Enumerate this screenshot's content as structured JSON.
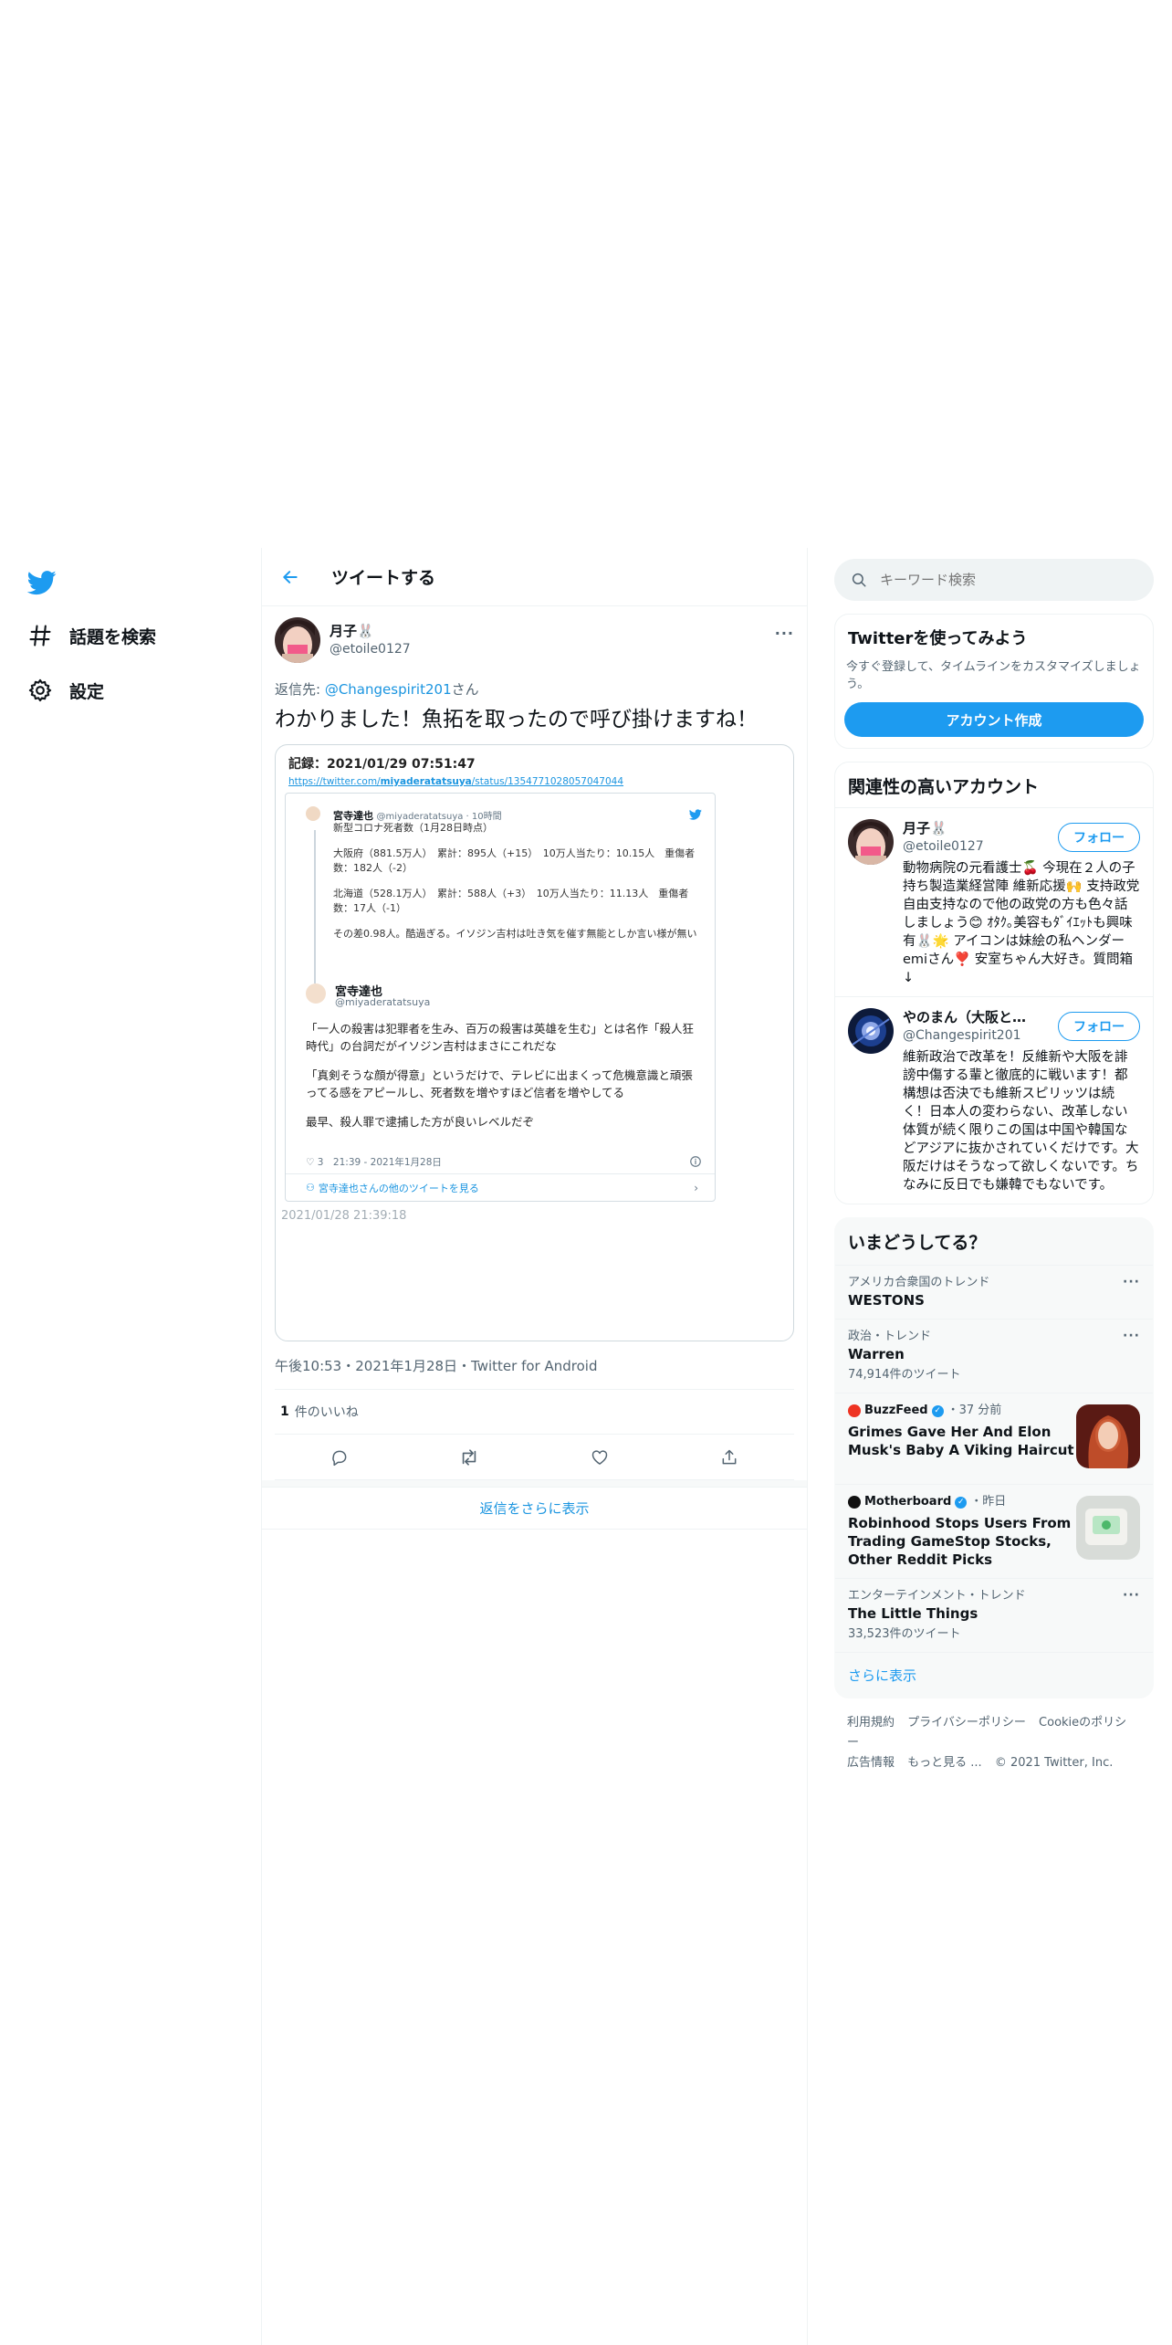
{
  "nav": {
    "explore_label": "話題を検索",
    "settings_label": "設定"
  },
  "header": {
    "title": "ツイートする"
  },
  "tweet": {
    "author_name": "月子🐰",
    "author_handle": "@etoile0127",
    "reply_prefix": "返信先: ",
    "reply_handle": "@Changespirit201",
    "reply_suffix": "さん",
    "text": "わかりました！魚拓を取ったので呼び掛けますね！",
    "timestamp": "午後10:53・2021年1月28日・Twitter for Android",
    "likes_count": "1",
    "likes_label": "件のいいね",
    "show_more_replies": "返信をさらに表示"
  },
  "embed": {
    "record": "記録：2021/01/29 07:51:47",
    "url_prefix": "https://twitter.com/",
    "url_user": "miyaderatatsuya",
    "url_suffix": "/status/1354771028057047044",
    "quoted_name": "宮寺達也",
    "quoted_handle_time": "@miyaderatatsuya · 10時間",
    "quoted_lines": [
      "新型コロナ死者数（1月28日時点）",
      "大阪府（881.5万人）　累計：895人（+15）　10万人当たり：10.15人　重傷者数：182人（-2）",
      "北海道（528.1万人）　累計：588人（+3）　10万人当たり：11.13人　重傷者数：17人（-1）",
      "その差0.98人。酷過ぎる。イソジン吉村は吐き気を催す無能としか言い様が無い"
    ],
    "main_name": "宮寺達也",
    "main_handle": "@miyaderatatsuya",
    "main_lines": [
      "「一人の殺害は犯罪者を生み、百万の殺害は英雄を生む」とは名作「殺人狂時代」の台詞だがイソジン吉村はまさにこれだな",
      "「真剣そうな顔が得意」というだけで、テレビに出まくって危機意識と頑張ってる感をアピールし、死者数を増やすほど信者を増やしてる",
      "最早、殺人罪で逮捕した方が良いレベルだぞ"
    ],
    "main_meta": "♡ 3　21:39 - 2021年1月28日",
    "more_tweets": "宮寺達也さんの他のツイートを見る",
    "captured_at": "2021/01/28 21:39:18"
  },
  "search": {
    "placeholder": "キーワード検索"
  },
  "signup": {
    "title": "Twitterを使ってみよう",
    "desc": "今すぐ登録して、タイムラインをカスタマイズしましょう。",
    "button": "アカウント作成"
  },
  "relevant": {
    "title": "関連性の高いアカウント",
    "follow_label": "フォロー",
    "accounts": [
      {
        "name": "月子🐰",
        "handle": "@etoile0127",
        "bio": "動物病院の元看護士🍒 今現在２人の子持ち製造業経営陣 維新応援🙌 支持政党自由支持なので他の政党の方も色々話しましょう😊 ｵﾀｸ｡美容もﾀﾞｲｴｯﾄも興味有🐰🌟 アイコンは妹絵の私ヘンダーemiさん❣️ 安室ちゃん大好き。質問箱↓"
      },
      {
        "name": "やのまん（大阪と維...",
        "handle": "@Changespirit201",
        "bio": "維新政治で改革を！反維新や大阪を誹謗中傷する輩と徹底的に戦います！都構想は否決でも維新スピリッツは続く！日本人の変わらない、改革しない体質が続く限りこの国は中国や韓国などアジアに抜かされていくだけです。大阪だけはそうなって欲しくないです。ちなみに反日でも嫌韓でもないです。"
      }
    ]
  },
  "trends": {
    "title": "いまどうしてる？",
    "items": [
      {
        "category": "アメリカ合衆国のトレンド",
        "name": "WESTONS",
        "count": ""
      },
      {
        "category": "政治・トレンド",
        "name": "Warren",
        "count": "74,914件のツイート"
      }
    ],
    "news": [
      {
        "source": "BuzzFeed",
        "time": "・37 分前",
        "title": "Grimes Gave Her And Elon Musk's Baby A Viking Haircut"
      },
      {
        "source": "Motherboard",
        "time": "・昨日",
        "title": "Robinhood Stops Users From Trading GameStop Stocks, Other Reddit Picks"
      }
    ],
    "last": {
      "category": "エンターテインメント・トレンド",
      "name": "The Little Things",
      "count": "33,523件のツイート"
    },
    "show_more": "さらに表示"
  },
  "footer": {
    "links": [
      "利用規約",
      "プライバシーポリシー",
      "Cookieのポリシー",
      "広告情報",
      "もっと見る ...",
      "© 2021 Twitter, Inc."
    ]
  },
  "colors": {
    "accent": "#1d9bf0",
    "link": "#1b95e0",
    "text_secondary": "#536471"
  }
}
